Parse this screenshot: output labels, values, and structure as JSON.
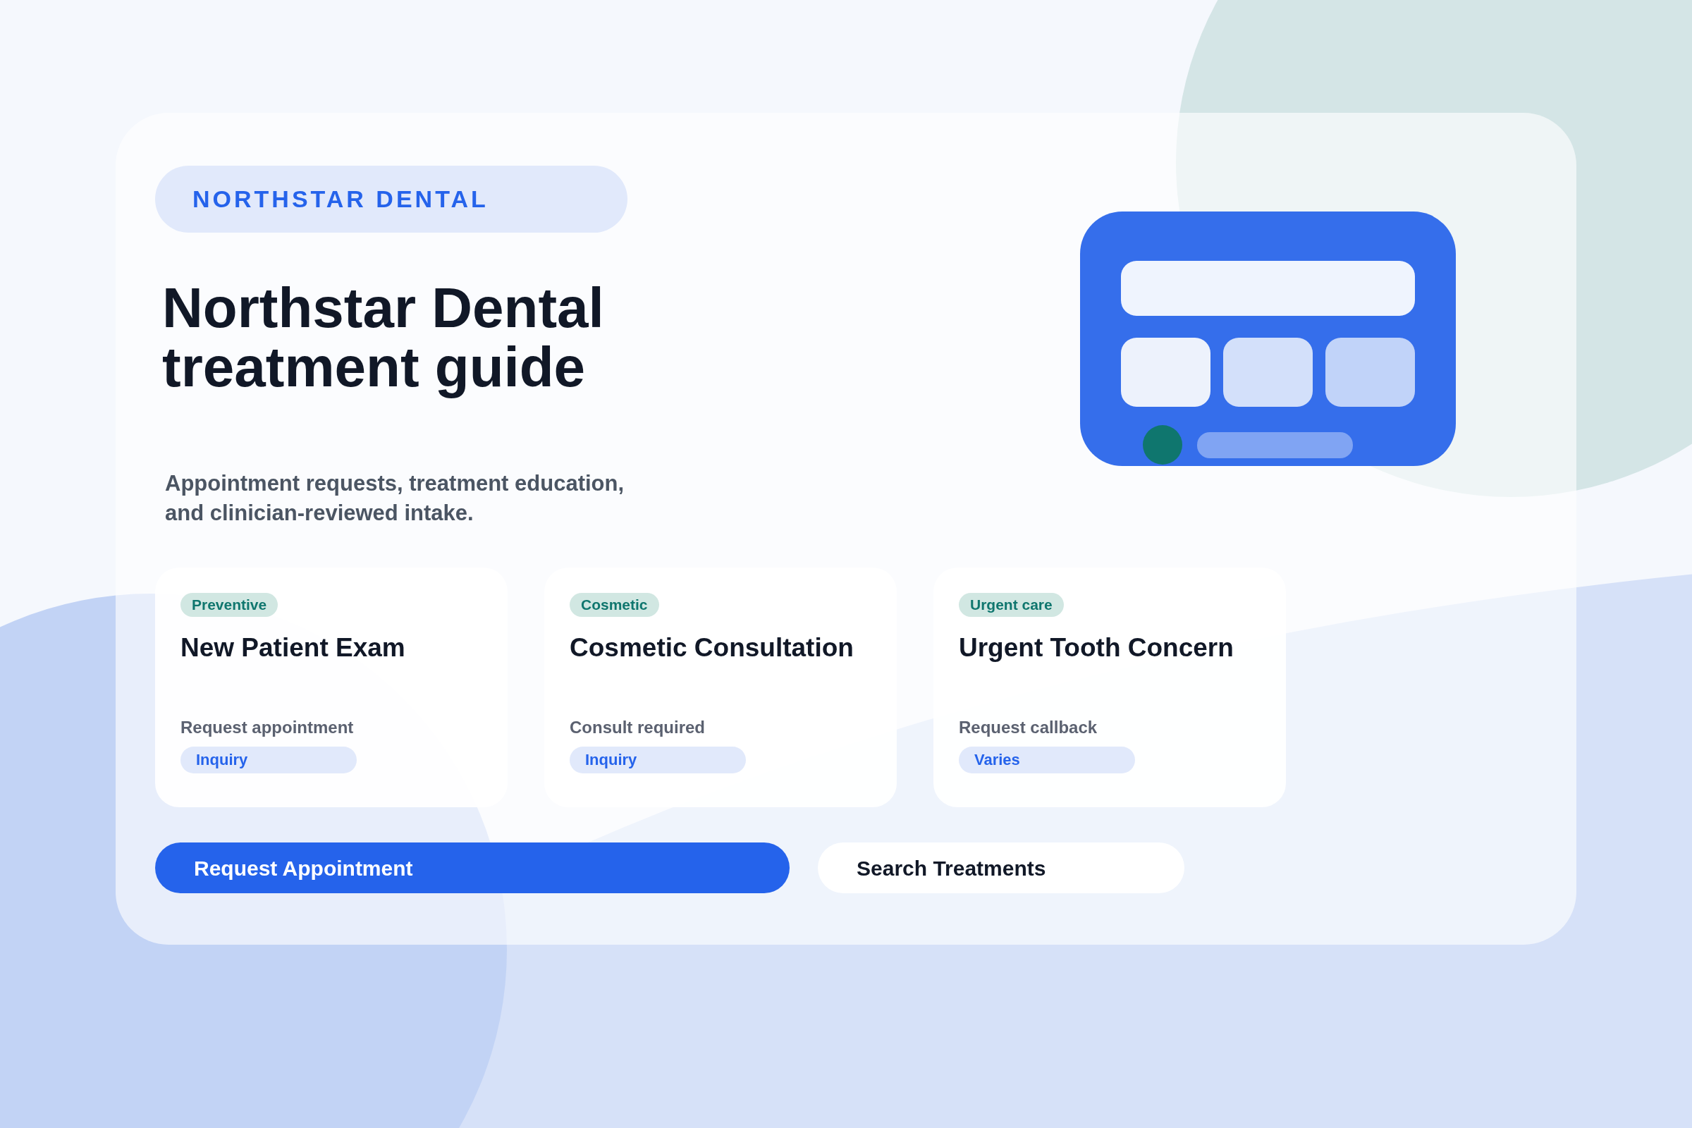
{
  "brand": "NORTHSTAR DENTAL",
  "title_lines": [
    "Northstar Dental",
    "treatment guide"
  ],
  "subtitle_lines": [
    "Appointment requests, treatment education,",
    "and clinician-reviewed intake."
  ],
  "cards": [
    {
      "tag": "Preventive",
      "title": "New Patient Exam",
      "note": "Request appointment",
      "pill": "Inquiry"
    },
    {
      "tag": "Cosmetic",
      "title": "Cosmetic Consultation",
      "note": "Consult required",
      "pill": "Inquiry"
    },
    {
      "tag": "Urgent care",
      "title": "Urgent Tooth Concern",
      "note": "Request callback",
      "pill": "Varies"
    }
  ],
  "buttons": [
    {
      "label": "Request Appointment",
      "kind": "primary"
    },
    {
      "label": "Search Treatments",
      "kind": "secondary"
    }
  ]
}
